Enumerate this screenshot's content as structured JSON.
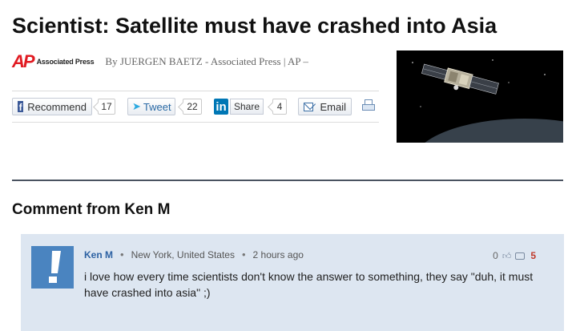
{
  "article": {
    "headline": "Scientist: Satellite must have crashed into Asia",
    "source_logo": "AP",
    "source_name": "Associated Press",
    "byline": "By JUERGEN BAETZ - Associated Press | AP –",
    "image_icon": "satellite-photo"
  },
  "share": {
    "recommend_label": "Recommend",
    "recommend_count": "17",
    "tweet_label": "Tweet",
    "tweet_count": "22",
    "share_label": "Share",
    "share_count": "4",
    "email_label": "Email",
    "print_icon": "printer-icon"
  },
  "comments": {
    "section_title": "Comment from Ken M",
    "items": [
      {
        "author": "Ken M",
        "location": "New York, United States",
        "time": "2 hours ago",
        "likes": "0",
        "replies": "5",
        "text": "i love how every time scientists don't know the answer to something, they say \"duh, it must have crashed into asia\" ;)"
      }
    ]
  },
  "colors": {
    "ap_red": "#e11b22",
    "author_link": "#2d62a3",
    "comment_bg": "#dde6f1",
    "avatar_bg": "#4a84c0",
    "reply_count": "#c0392b",
    "divider": "#4a5360"
  }
}
